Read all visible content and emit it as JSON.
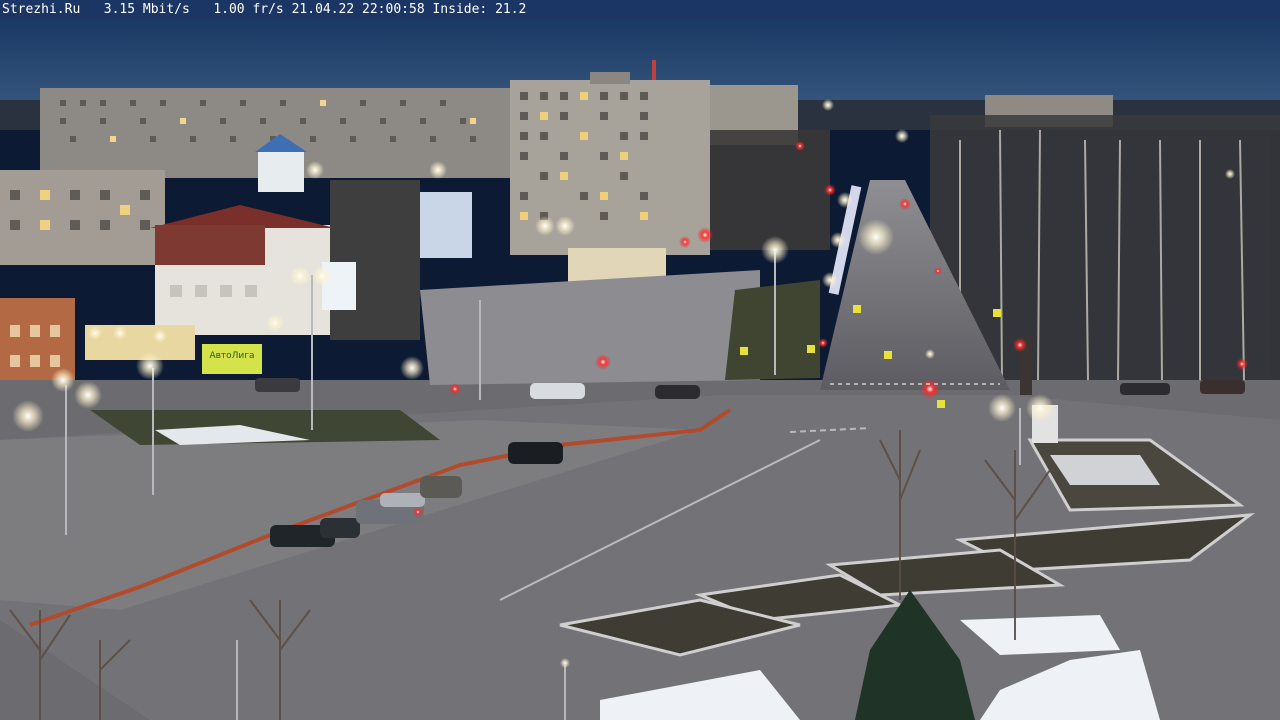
{
  "overlay": {
    "text": "Strezhi.Ru   3.15 Mbit/s   1.00 fr/s 21.04.22 22:00:58 Inside: 21.2"
  },
  "signs": {
    "store_sign": "АвтоЛига"
  },
  "colors": {
    "overlay_bar": "#1b3565",
    "overlay_text": "#ffffff",
    "sky": "#1e3f6b",
    "street_light": "#fff6d8"
  },
  "scene": {
    "type": "webcam-night-street-view",
    "time_of_day": "dusk"
  }
}
